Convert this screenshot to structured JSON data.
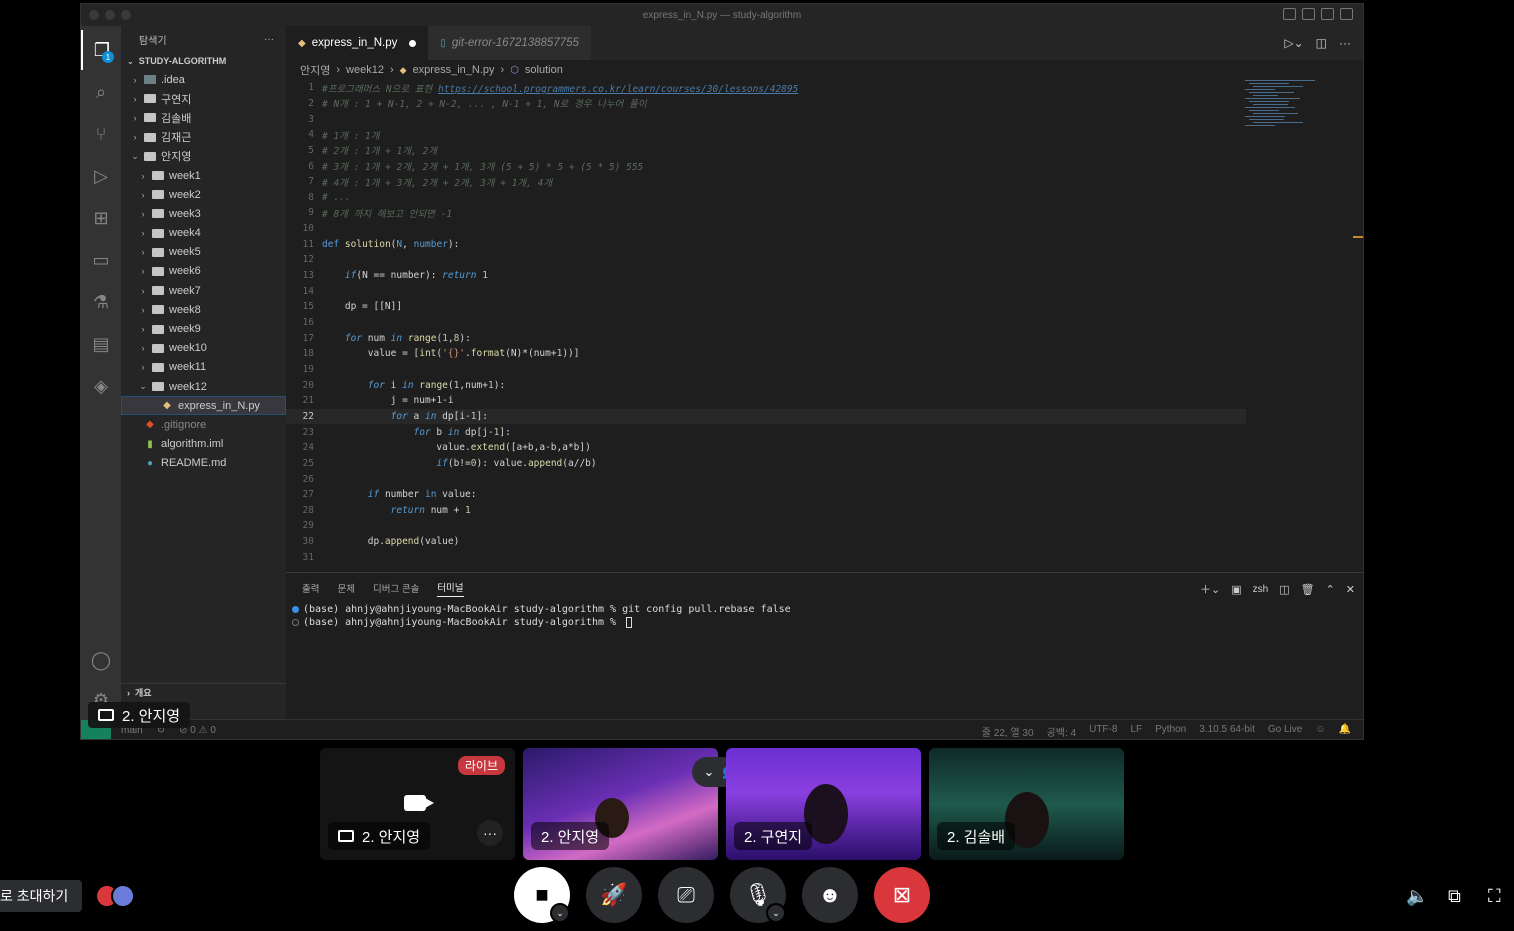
{
  "window": {
    "title": "express_in_N.py — study-algorithm"
  },
  "activity": {
    "badge": "1"
  },
  "sidebar": {
    "header": "탐색기",
    "more": "···",
    "root": "STUDY-ALGORITHM",
    "items": [
      {
        "label": ".idea",
        "depth": 0,
        "type": "folder",
        "open": false
      },
      {
        "label": "구연지",
        "depth": 0,
        "type": "folder",
        "open": false
      },
      {
        "label": "김솔배",
        "depth": 0,
        "type": "folder",
        "open": false
      },
      {
        "label": "김재근",
        "depth": 0,
        "type": "folder",
        "open": false
      },
      {
        "label": "안지영",
        "depth": 0,
        "type": "folder",
        "open": true
      },
      {
        "label": "week1",
        "depth": 1,
        "type": "folder",
        "open": false
      },
      {
        "label": "week2",
        "depth": 1,
        "type": "folder",
        "open": false
      },
      {
        "label": "week3",
        "depth": 1,
        "type": "folder",
        "open": false
      },
      {
        "label": "week4",
        "depth": 1,
        "type": "folder",
        "open": false
      },
      {
        "label": "week5",
        "depth": 1,
        "type": "folder",
        "open": false
      },
      {
        "label": "week6",
        "depth": 1,
        "type": "folder",
        "open": false
      },
      {
        "label": "week7",
        "depth": 1,
        "type": "folder",
        "open": false
      },
      {
        "label": "week8",
        "depth": 1,
        "type": "folder",
        "open": false
      },
      {
        "label": "week9",
        "depth": 1,
        "type": "folder",
        "open": false
      },
      {
        "label": "week10",
        "depth": 1,
        "type": "folder",
        "open": false
      },
      {
        "label": "week11",
        "depth": 1,
        "type": "folder",
        "open": false
      },
      {
        "label": "week12",
        "depth": 1,
        "type": "folder",
        "open": true
      },
      {
        "label": "express_in_N.py",
        "depth": 2,
        "type": "python",
        "selected": true
      },
      {
        "label": ".gitignore",
        "depth": 0,
        "type": "git"
      },
      {
        "label": "algorithm.iml",
        "depth": 0,
        "type": "iml"
      },
      {
        "label": "README.md",
        "depth": 0,
        "type": "info"
      }
    ],
    "outline": "개요"
  },
  "editor": {
    "tabs": [
      {
        "label": "express_in_N.py",
        "modified": true
      },
      {
        "label": "git-error-1672138857755"
      }
    ],
    "breadcrumb": [
      "안지영",
      "week12",
      "express_in_N.py",
      "solution"
    ],
    "lines": [
      {
        "n": "1",
        "html": "<span class='cm'>#프로그래머스 N으로 표현 </span><span class='link'>https://school.programmers.co.kr/learn/courses/30/lessons/42895</span>"
      },
      {
        "n": "2",
        "html": "<span class='cm'># N개 : 1 + N-1, 2 + N-2, ... , N-1 + 1, N로 경우 나누어 풀이</span>"
      },
      {
        "n": "3",
        "html": ""
      },
      {
        "n": "4",
        "html": "<span class='cm'># 1개 : 1개</span>"
      },
      {
        "n": "5",
        "html": "<span class='cm'># 2개 : 1개 + 1개, 2개</span>"
      },
      {
        "n": "6",
        "html": "<span class='cm'># 3개 : 1개 + 2개, 2개 + 1개, 3개 (5 + 5) * 5 + (5 * 5) 555</span>"
      },
      {
        "n": "7",
        "html": "<span class='cm'># 4개 : 1개 + 3개, 2개 + 2개, 3개 + 1개, 4개</span>"
      },
      {
        "n": "8",
        "html": "<span class='cm'># ...</span>"
      },
      {
        "n": "9",
        "html": "<span class='cm'># 8개 까지 해보고 안되면 -1</span>"
      },
      {
        "n": "10",
        "html": ""
      },
      {
        "n": "11",
        "html": "<span class='kw'>def</span> <span class='fn'>solution</span>(<span class='kw'>N</span>, <span class='kw'>number</span>):"
      },
      {
        "n": "12",
        "html": ""
      },
      {
        "n": "13",
        "html": "    <span class='kwi'>if</span>(N == number): <span class='kwi'>return</span> <span class='num'>1</span>"
      },
      {
        "n": "14",
        "html": ""
      },
      {
        "n": "15",
        "html": "    dp = [[N]]"
      },
      {
        "n": "16",
        "html": ""
      },
      {
        "n": "17",
        "html": "    <span class='kwi'>for</span> num <span class='kwi'>in</span> <span class='fn'>range</span>(<span class='num'>1</span>,<span class='num'>8</span>):"
      },
      {
        "n": "18",
        "html": "        value = [<span class='fn'>int</span>(<span class='str'>'{}'</span>.<span class='fn'>format</span>(N)*(num+<span class='num'>1</span>))]"
      },
      {
        "n": "19",
        "html": ""
      },
      {
        "n": "20",
        "html": "        <span class='kwi'>for</span> i <span class='kwi'>in</span> <span class='fn'>range</span>(<span class='num'>1</span>,num+<span class='num'>1</span>):"
      },
      {
        "n": "21",
        "html": "            j = num+<span class='num'>1</span>-i"
      },
      {
        "n": "22",
        "html": "            <span class='kwi'>for</span> a <span class='kwi'>in</span> dp[i-<span class='num'>1</span>]:",
        "current": true
      },
      {
        "n": "23",
        "html": "                <span class='kwi'>for</span> b <span class='kwi'>in</span> dp[j-<span class='num'>1</span>]:"
      },
      {
        "n": "24",
        "html": "                    value.<span class='fn'>extend</span>([a+b,a-b,a*b])"
      },
      {
        "n": "25",
        "html": "                    <span class='kwi'>if</span>(b!=<span class='num'>0</span>): value.<span class='fn'>append</span>(a//b)"
      },
      {
        "n": "26",
        "html": ""
      },
      {
        "n": "27",
        "html": "        <span class='kwi'>if</span> number <span class='kw'>in</span> value:"
      },
      {
        "n": "28",
        "html": "            <span class='kwi'>return</span> num + <span class='num'>1</span>"
      },
      {
        "n": "29",
        "html": ""
      },
      {
        "n": "30",
        "html": "        dp.<span class='fn'>append</span>(value)"
      },
      {
        "n": "31",
        "html": ""
      }
    ]
  },
  "panel": {
    "tabs": [
      "출력",
      "문제",
      "디버그 콘솔",
      "터미널"
    ],
    "active_tab": "터미널",
    "shell": "zsh",
    "terminal": [
      {
        "text": "(base) ahnjy@ahnjiyoung-MacBookAir study-algorithm % git config pull.rebase false",
        "dot": "#3b8eea"
      },
      {
        "text": "(base) ahnjy@ahnjiyoung-MacBookAir study-algorithm % ",
        "dot": "#777",
        "cursor": true
      }
    ]
  },
  "statusbar": {
    "branch": "main",
    "problems": "⊘ 0 ⚠ 0",
    "position": "줄 22, 열 30",
    "spaces": "공백: 4",
    "encoding": "UTF-8",
    "eol": "LF",
    "language": "Python",
    "interpreter": "3.10.5 64-bit",
    "golive": "Go Live"
  },
  "share": {
    "label": "2. 안지영"
  },
  "tiles": [
    {
      "label": "2. 안지영",
      "live": "라이브",
      "screen": true
    },
    {
      "label": "2. 안지영"
    },
    {
      "label": "2. 구연지"
    },
    {
      "label": "2. 김솔배"
    }
  ],
  "bottom": {
    "invite": "로 초대하기"
  },
  "colors": {
    "accent": "#da373c",
    "activity_bg": "#333333",
    "editor_bg": "#1e1e1e"
  }
}
